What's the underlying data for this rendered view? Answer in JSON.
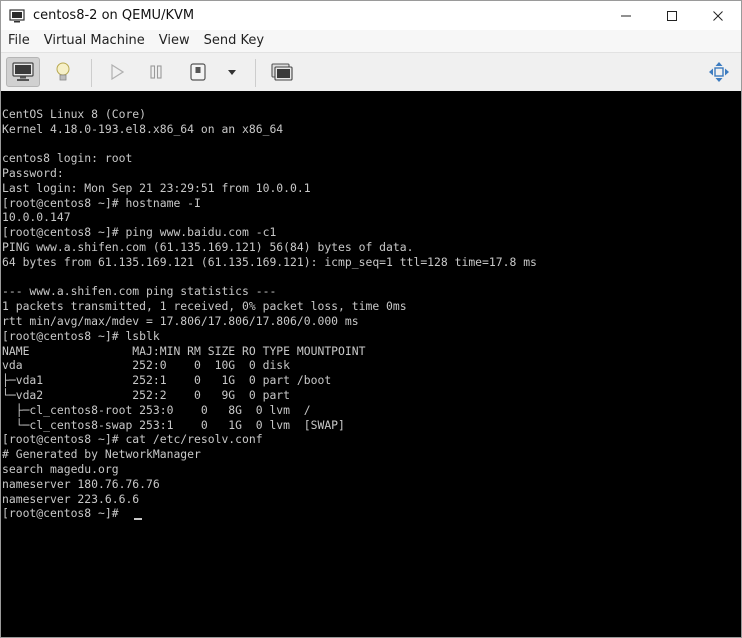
{
  "window": {
    "title": "centos8-2 on QEMU/KVM",
    "minimize_glyph": "—",
    "maximize_glyph": "☐",
    "close_glyph": "✕"
  },
  "menu": {
    "items": [
      "File",
      "Virtual Machine",
      "View",
      "Send Key"
    ]
  },
  "toolbar": {
    "icons": [
      "monitor-icon",
      "lightbulb-icon",
      "play-icon",
      "pause-icon",
      "power-icon",
      "dropdown-arrow-icon",
      "screenshot-icon",
      "fullscreen-move-icon"
    ]
  },
  "terminal": {
    "lines": [
      "",
      "CentOS Linux 8 (Core)",
      "Kernel 4.18.0-193.el8.x86_64 on an x86_64",
      "",
      "centos8 login: root",
      "Password:",
      "Last login: Mon Sep 21 23:29:51 from 10.0.0.1",
      "[root@centos8 ~]# hostname -I",
      "10.0.0.147",
      "[root@centos8 ~]# ping www.baidu.com -c1",
      "PING www.a.shifen.com (61.135.169.121) 56(84) bytes of data.",
      "64 bytes from 61.135.169.121 (61.135.169.121): icmp_seq=1 ttl=128 time=17.8 ms",
      "",
      "--- www.a.shifen.com ping statistics ---",
      "1 packets transmitted, 1 received, 0% packet loss, time 0ms",
      "rtt min/avg/max/mdev = 17.806/17.806/17.806/0.000 ms",
      "[root@centos8 ~]# lsblk",
      "NAME               MAJ:MIN RM SIZE RO TYPE MOUNTPOINT",
      "vda                252:0    0  10G  0 disk",
      "├─vda1             252:1    0   1G  0 part /boot",
      "└─vda2             252:2    0   9G  0 part",
      "  ├─cl_centos8-root 253:0    0   8G  0 lvm  /",
      "  └─cl_centos8-swap 253:1    0   1G  0 lvm  [SWAP]",
      "[root@centos8 ~]# cat /etc/resolv.conf",
      "# Generated by NetworkManager",
      "search magedu.org",
      "nameserver 180.76.76.76",
      "nameserver 223.6.6.6",
      "[root@centos8 ~]#"
    ]
  },
  "colors": {
    "console_bg": "#000000",
    "console_fg": "#c8c8c8",
    "toolbar_bg": "#f0f0f0"
  }
}
